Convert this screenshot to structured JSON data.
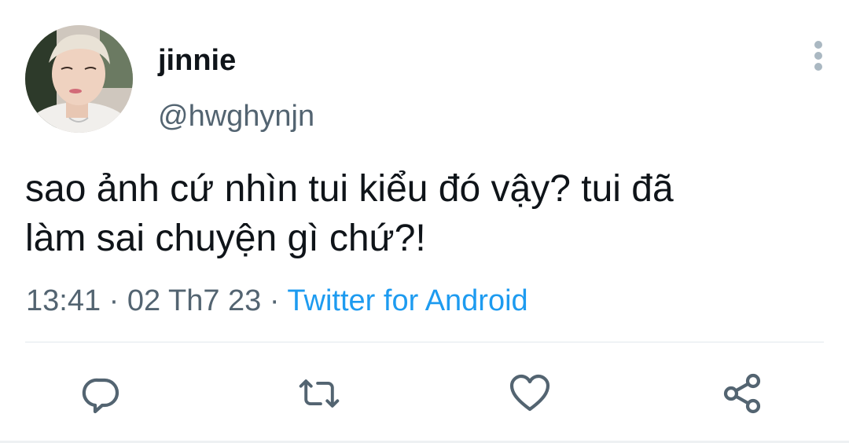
{
  "tweet": {
    "display_name": "jinnie",
    "handle": "@hwghynjn",
    "text": "sao ảnh cứ nhìn tui kiểu đó vậy? tui đã\nlàm sai chuyện gì chứ?!",
    "time": "13:41",
    "separator": " · ",
    "date": "02 Th7 23",
    "source": "Twitter for Android"
  },
  "icons": {
    "more": "more-vertical-icon",
    "reply": "reply-icon",
    "retweet": "retweet-icon",
    "like": "heart-icon",
    "share": "share-icon"
  },
  "colors": {
    "text": "#0f1419",
    "secondary": "#536471",
    "link": "#1d9bf0",
    "icon": "#536471",
    "divider": "#e1e8ed"
  }
}
